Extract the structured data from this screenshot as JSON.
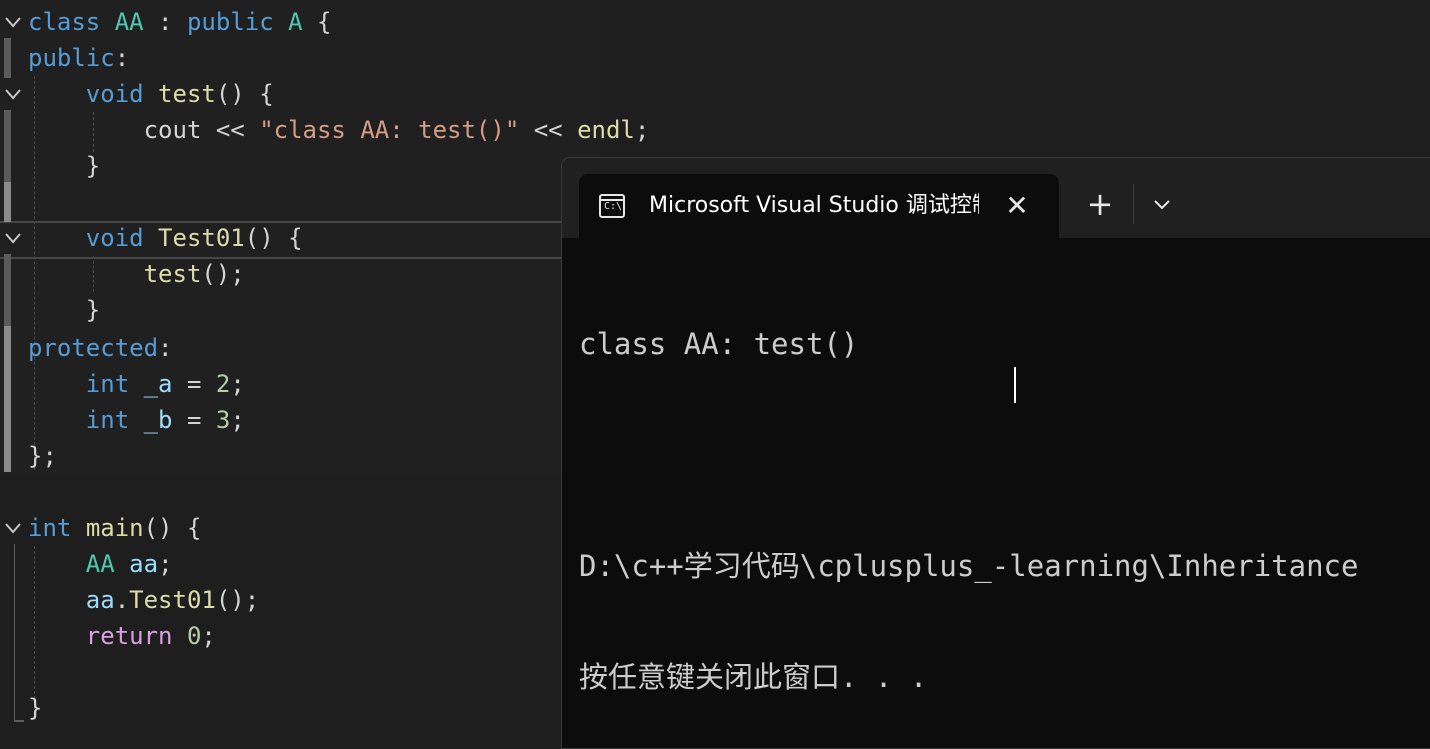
{
  "editor": {
    "lines": [
      [
        {
          "t": "class",
          "c": "kw"
        },
        {
          "t": " ",
          "c": "pl"
        },
        {
          "t": "AA",
          "c": "ty"
        },
        {
          "t": " : ",
          "c": "pl"
        },
        {
          "t": "public",
          "c": "kw"
        },
        {
          "t": " ",
          "c": "pl"
        },
        {
          "t": "A",
          "c": "ty"
        },
        {
          "t": " {",
          "c": "pl"
        }
      ],
      [
        {
          "t": "public",
          "c": "kw"
        },
        {
          "t": ":",
          "c": "pl"
        }
      ],
      [
        {
          "t": "    ",
          "c": "pl"
        },
        {
          "t": "void",
          "c": "kw"
        },
        {
          "t": " ",
          "c": "pl"
        },
        {
          "t": "test",
          "c": "fn"
        },
        {
          "t": "() {",
          "c": "pl"
        }
      ],
      [
        {
          "t": "        ",
          "c": "pl"
        },
        {
          "t": "cout",
          "c": "pl"
        },
        {
          "t": " << ",
          "c": "pl"
        },
        {
          "t": "\"class AA: test()\"",
          "c": "st"
        },
        {
          "t": " << ",
          "c": "pl"
        },
        {
          "t": "endl",
          "c": "fn"
        },
        {
          "t": ";",
          "c": "pl"
        }
      ],
      [
        {
          "t": "    }",
          "c": "pl"
        }
      ],
      [],
      [
        {
          "t": "    ",
          "c": "pl"
        },
        {
          "t": "void",
          "c": "kw"
        },
        {
          "t": " ",
          "c": "pl"
        },
        {
          "t": "Test01",
          "c": "fn"
        },
        {
          "t": "() {",
          "c": "pl"
        }
      ],
      [
        {
          "t": "        ",
          "c": "pl"
        },
        {
          "t": "test",
          "c": "fn"
        },
        {
          "t": "();",
          "c": "pl"
        }
      ],
      [
        {
          "t": "    }",
          "c": "pl"
        }
      ],
      [
        {
          "t": "protected",
          "c": "kw"
        },
        {
          "t": ":",
          "c": "pl"
        }
      ],
      [
        {
          "t": "    ",
          "c": "pl"
        },
        {
          "t": "int",
          "c": "kw"
        },
        {
          "t": " ",
          "c": "pl"
        },
        {
          "t": "_a",
          "c": "vr"
        },
        {
          "t": " = ",
          "c": "pl"
        },
        {
          "t": "2",
          "c": "nm"
        },
        {
          "t": ";",
          "c": "pl"
        }
      ],
      [
        {
          "t": "    ",
          "c": "pl"
        },
        {
          "t": "int",
          "c": "kw"
        },
        {
          "t": " ",
          "c": "pl"
        },
        {
          "t": "_b",
          "c": "vr"
        },
        {
          "t": " = ",
          "c": "pl"
        },
        {
          "t": "3",
          "c": "nm"
        },
        {
          "t": ";",
          "c": "pl"
        }
      ],
      [
        {
          "t": "};",
          "c": "pl"
        }
      ],
      [],
      [
        {
          "t": "int",
          "c": "kw"
        },
        {
          "t": " ",
          "c": "pl"
        },
        {
          "t": "main",
          "c": "fn"
        },
        {
          "t": "() {",
          "c": "pl"
        }
      ],
      [
        {
          "t": "    ",
          "c": "pl"
        },
        {
          "t": "AA",
          "c": "ty"
        },
        {
          "t": " ",
          "c": "pl"
        },
        {
          "t": "aa",
          "c": "vr"
        },
        {
          "t": ";",
          "c": "pl"
        }
      ],
      [
        {
          "t": "    ",
          "c": "pl"
        },
        {
          "t": "aa",
          "c": "vr"
        },
        {
          "t": ".",
          "c": "pl"
        },
        {
          "t": "Test01",
          "c": "fn"
        },
        {
          "t": "();",
          "c": "pl"
        }
      ],
      [
        {
          "t": "    ",
          "c": "pl"
        },
        {
          "t": "return",
          "c": "ctl"
        },
        {
          "t": " ",
          "c": "pl"
        },
        {
          "t": "0",
          "c": "nm"
        },
        {
          "t": ";",
          "c": "pl"
        }
      ],
      [],
      [
        {
          "t": "}",
          "c": "pl"
        }
      ]
    ]
  },
  "terminal": {
    "tab_title": "Microsoft Visual Studio 调试控制台",
    "tab_icon_text": "C:\\",
    "close_icon": "✕",
    "new_tab_icon": "+",
    "dropdown_icon": "chevron-down-icon",
    "output_lines": [
      "class AA: test()",
      "",
      "D:\\c++学习代码\\cplusplus_-learning\\Inheritance",
      "按任意键关闭此窗口. . ."
    ]
  },
  "colors": {
    "editor_bg": "#1e1e1e",
    "keyword": "#569cd6",
    "type": "#4ec9b0",
    "function": "#dcdcaa",
    "variable": "#9cdcfe",
    "string": "#d69d85",
    "number": "#b5cea8",
    "control": "#d8a0df",
    "terminal_bg": "#0c0c0c"
  }
}
